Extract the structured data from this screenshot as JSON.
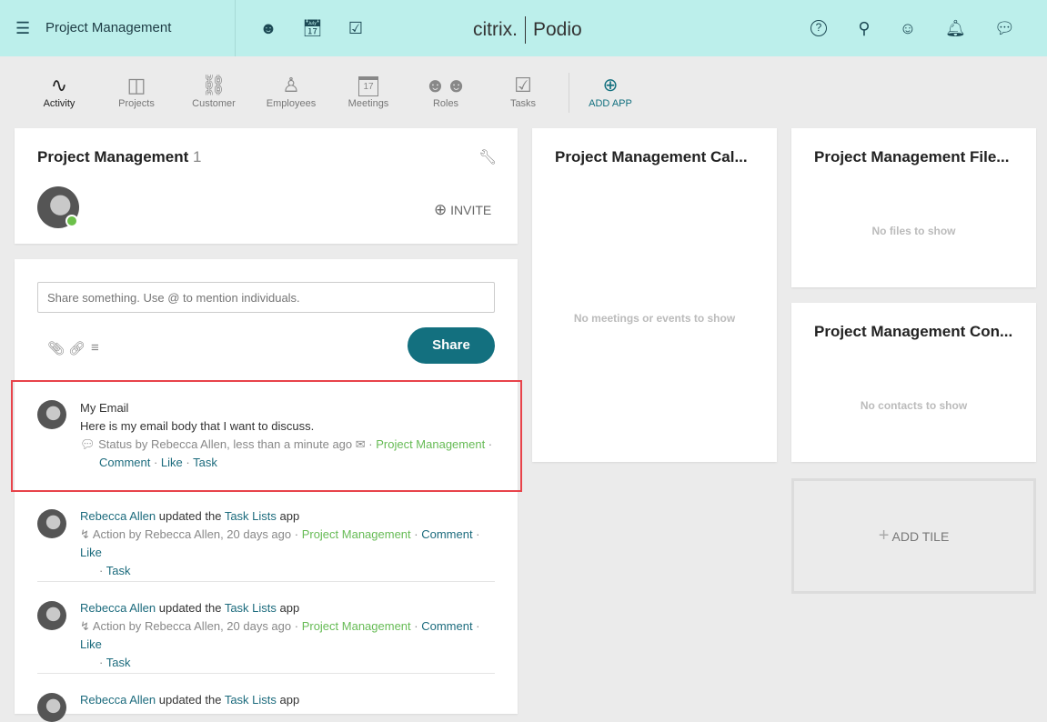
{
  "topbar": {
    "workspace": "Project Management",
    "logo_left": "citrix.",
    "logo_right": "Podio",
    "icons": [
      "menu-icon",
      "members-icon",
      "calendar-icon",
      "tasks-icon",
      "help-icon",
      "search-icon",
      "profile-icon",
      "bell-icon",
      "chat-icon"
    ]
  },
  "apps": [
    {
      "label": "Activity",
      "icon": "activity-icon"
    },
    {
      "label": "Projects",
      "icon": "projects-icon"
    },
    {
      "label": "Customer",
      "icon": "handshake-icon"
    },
    {
      "label": "Employees",
      "icon": "employee-icon"
    },
    {
      "label": "Meetings",
      "icon": "calendar-17-icon",
      "day": "17"
    },
    {
      "label": "Roles",
      "icon": "roles-icon"
    },
    {
      "label": "Tasks",
      "icon": "task-icon"
    }
  ],
  "add_app": "ADD APP",
  "workspace_card": {
    "title": "Project Management",
    "count": "1",
    "invite": "INVITE"
  },
  "share": {
    "placeholder": "Share something. Use @ to mention individuals.",
    "button": "Share"
  },
  "feed": [
    {
      "title": "My Email",
      "body": "Here is my email body that I want to discuss.",
      "type": "Status",
      "by": "by",
      "author": "Rebecca Allen",
      "time": ", less than a minute ago",
      "workspace": "Project Management",
      "actions": [
        "Comment",
        "Like",
        "Task"
      ]
    },
    {
      "actor": "Rebecca Allen",
      "verb": "updated the",
      "object": "Task Lists",
      "suffix": "app",
      "type": "Action",
      "by": "by",
      "author": "Rebecca Allen",
      "time": ", 20 days ago",
      "workspace": "Project Management",
      "actions": [
        "Comment",
        "Like",
        "Task"
      ]
    },
    {
      "actor": "Rebecca Allen",
      "verb": "updated the",
      "object": "Task Lists",
      "suffix": "app",
      "type": "Action",
      "by": "by",
      "author": "Rebecca Allen",
      "time": ", 20 days ago",
      "workspace": "Project Management",
      "actions": [
        "Comment",
        "Like",
        "Task"
      ]
    },
    {
      "actor": "Rebecca Allen",
      "verb": "updated the",
      "object": "Task Lists",
      "suffix": "app"
    }
  ],
  "calendar": {
    "title": "Project Management Cal...",
    "empty": "No meetings or events to show"
  },
  "files": {
    "title": "Project Management File...",
    "empty": "No files to show"
  },
  "contacts": {
    "title": "Project Management Con...",
    "empty": "No contacts to show"
  },
  "add_tile": "ADD TILE",
  "colors": {
    "topbar": "#bcefeb",
    "accent": "#13707f",
    "highlight": "#e8434a",
    "online": "#6cc04a",
    "workspace_link": "#66bb55"
  }
}
